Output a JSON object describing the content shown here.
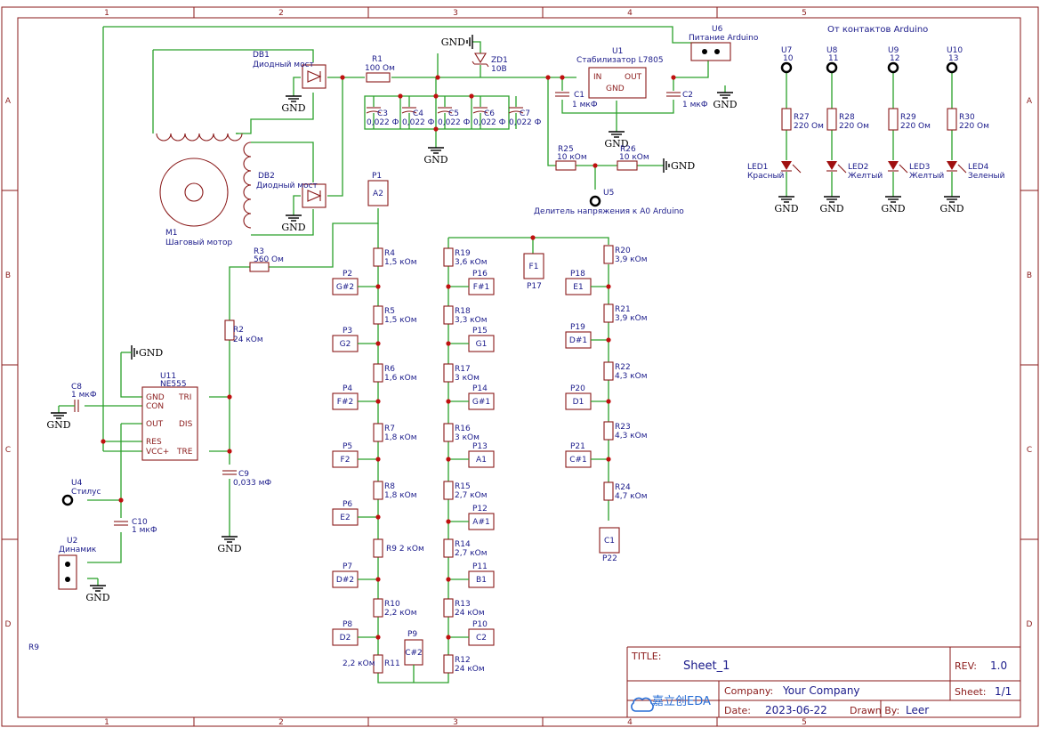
{
  "ruler": {
    "cols": [
      "1",
      "2",
      "3",
      "4",
      "5"
    ],
    "rows": [
      "A",
      "B",
      "C",
      "D"
    ]
  },
  "gnd_label": "GND",
  "stray_label": "R9",
  "arduino_header": "От контактов Arduino",
  "components": {
    "DB1": {
      "ref": "DB1",
      "name": "Диодный мост"
    },
    "DB2": {
      "ref": "DB2",
      "name": "Диодный мост"
    },
    "M1": {
      "ref": "M1",
      "name": "Шаговый мотор"
    },
    "R1": {
      "ref": "R1",
      "value": "100 Ом"
    },
    "ZD1": {
      "ref": "ZD1",
      "value": "10В"
    },
    "U1": {
      "ref": "U1",
      "name": "Стабилизатор L7805",
      "pin_in": "IN",
      "pin_out": "OUT",
      "pin_gnd": "GND"
    },
    "C1": {
      "ref": "C1",
      "value": "1 мкФ"
    },
    "C2": {
      "ref": "C2",
      "value": "1 мкФ"
    },
    "C3": {
      "ref": "C3",
      "value": "0,022 Ф"
    },
    "C4": {
      "ref": "C4",
      "value": "0,022 Ф"
    },
    "C5": {
      "ref": "C5",
      "value": "0,022 Ф"
    },
    "C6": {
      "ref": "C6",
      "value": "0,022 Ф"
    },
    "C7": {
      "ref": "C7",
      "value": "0,022 Ф"
    },
    "U6": {
      "ref": "U6",
      "name": "Питание Arduino"
    },
    "R25": {
      "ref": "R25",
      "value": "10 кОм"
    },
    "R26": {
      "ref": "R26",
      "value": "10 кОм"
    },
    "U5": {
      "ref": "U5",
      "name": "Делитель напряжения к A0 Arduino"
    },
    "R3": {
      "ref": "R3",
      "value": "560 Ом"
    },
    "R2": {
      "ref": "R2",
      "value": "24 кОм"
    },
    "U11": {
      "ref": "U11",
      "name": "NE555",
      "pins": [
        "GND",
        "CON",
        "OUT",
        "RES",
        "VCC+",
        "TRI",
        "DIS",
        "TRE"
      ]
    },
    "C8": {
      "ref": "C8",
      "value": "1 мкФ"
    },
    "C9": {
      "ref": "C9",
      "value": "0,033 мФ"
    },
    "C10": {
      "ref": "C10",
      "value": "1 мкФ"
    },
    "U4": {
      "ref": "U4",
      "name": "Стилус"
    },
    "U2": {
      "ref": "U2",
      "name": "Динамик"
    }
  },
  "leds": [
    {
      "conn": "U7",
      "pin": "10",
      "r": "R27",
      "rv": "220 Ом",
      "led": "LED1",
      "color": "Красный"
    },
    {
      "conn": "U8",
      "pin": "11",
      "r": "R28",
      "rv": "220 Ом",
      "led": "LED2",
      "color": "Желтый"
    },
    {
      "conn": "U9",
      "pin": "12",
      "r": "R29",
      "rv": "220 Ом",
      "led": "LED3",
      "color": "Желтый"
    },
    {
      "conn": "U10",
      "pin": "13",
      "r": "R30",
      "rv": "220 Ом",
      "led": "LED4",
      "color": "Зеленый"
    }
  ],
  "ladder1": {
    "top_pad": {
      "ref": "P1",
      "note": "A2"
    },
    "resistors": [
      {
        "ref": "R4",
        "value": "1,5 кОм"
      },
      {
        "ref": "R5",
        "value": "1,5 кОм"
      },
      {
        "ref": "R6",
        "value": "1,6 кОм"
      },
      {
        "ref": "R7",
        "value": "1,8 кОм"
      },
      {
        "ref": "R8",
        "value": "1,8 кОм"
      },
      {
        "ref": "R9",
        "value": "2 кОм"
      },
      {
        "ref": "R10",
        "value": "2,2 кОм"
      },
      {
        "ref": "R11",
        "value": "2,2 кОм"
      }
    ],
    "pads": [
      {
        "ref": "P2",
        "note": "G#2"
      },
      {
        "ref": "P3",
        "note": "G2"
      },
      {
        "ref": "P4",
        "note": "F#2"
      },
      {
        "ref": "P5",
        "note": "F2"
      },
      {
        "ref": "P6",
        "note": "E2"
      },
      {
        "ref": "P7",
        "note": "D#2"
      },
      {
        "ref": "P8",
        "note": "D2"
      }
    ],
    "bottom_pad": {
      "ref": "P9",
      "note": "C#2"
    }
  },
  "ladder2": {
    "resistors": [
      {
        "ref": "R19",
        "value": "3,6 кОм"
      },
      {
        "ref": "R18",
        "value": "3,3 кОм"
      },
      {
        "ref": "R17",
        "value": "3 кОм"
      },
      {
        "ref": "R16",
        "value": "3 кОм"
      },
      {
        "ref": "R15",
        "value": "2,7 кОм"
      },
      {
        "ref": "R14",
        "value": "2,7 кОм"
      },
      {
        "ref": "R13",
        "value": "24 кОм"
      },
      {
        "ref": "R12",
        "value": "24 кОм"
      }
    ],
    "pads": [
      {
        "ref": "P16",
        "note": "F#1"
      },
      {
        "ref": "P15",
        "note": "G1"
      },
      {
        "ref": "P14",
        "note": "G#1"
      },
      {
        "ref": "P13",
        "note": "A1"
      },
      {
        "ref": "P12",
        "note": "A#1"
      },
      {
        "ref": "P11",
        "note": "B1"
      },
      {
        "ref": "P10",
        "note": "C2"
      }
    ],
    "top_pad": {
      "ref": "P17",
      "note": "F1"
    }
  },
  "ladder3": {
    "resistors": [
      {
        "ref": "R20",
        "value": "3,9 кОм"
      },
      {
        "ref": "R21",
        "value": "3,9 кОм"
      },
      {
        "ref": "R22",
        "value": "4,3 кОм"
      },
      {
        "ref": "R23",
        "value": "4,3 кОм"
      },
      {
        "ref": "R24",
        "value": "4,7 кОм"
      }
    ],
    "pads": [
      {
        "ref": "P18",
        "note": "E1"
      },
      {
        "ref": "P19",
        "note": "D#1"
      },
      {
        "ref": "P20",
        "note": "D1"
      },
      {
        "ref": "P21",
        "note": "C#1"
      }
    ],
    "bottom_pad": {
      "ref": "P22",
      "note": "C1"
    }
  },
  "title_block": {
    "title_label": "TITLE:",
    "title": "Sheet_1",
    "rev_label": "REV:",
    "rev": "1.0",
    "company_label": "Company:",
    "company": "Your Company",
    "sheet_label": "Sheet:",
    "sheet": "1/1",
    "date_label": "Date:",
    "date": "2023-06-22",
    "drawn_label": "Drawn By:",
    "drawn": "Leer",
    "logo": "嘉立创EDA"
  }
}
